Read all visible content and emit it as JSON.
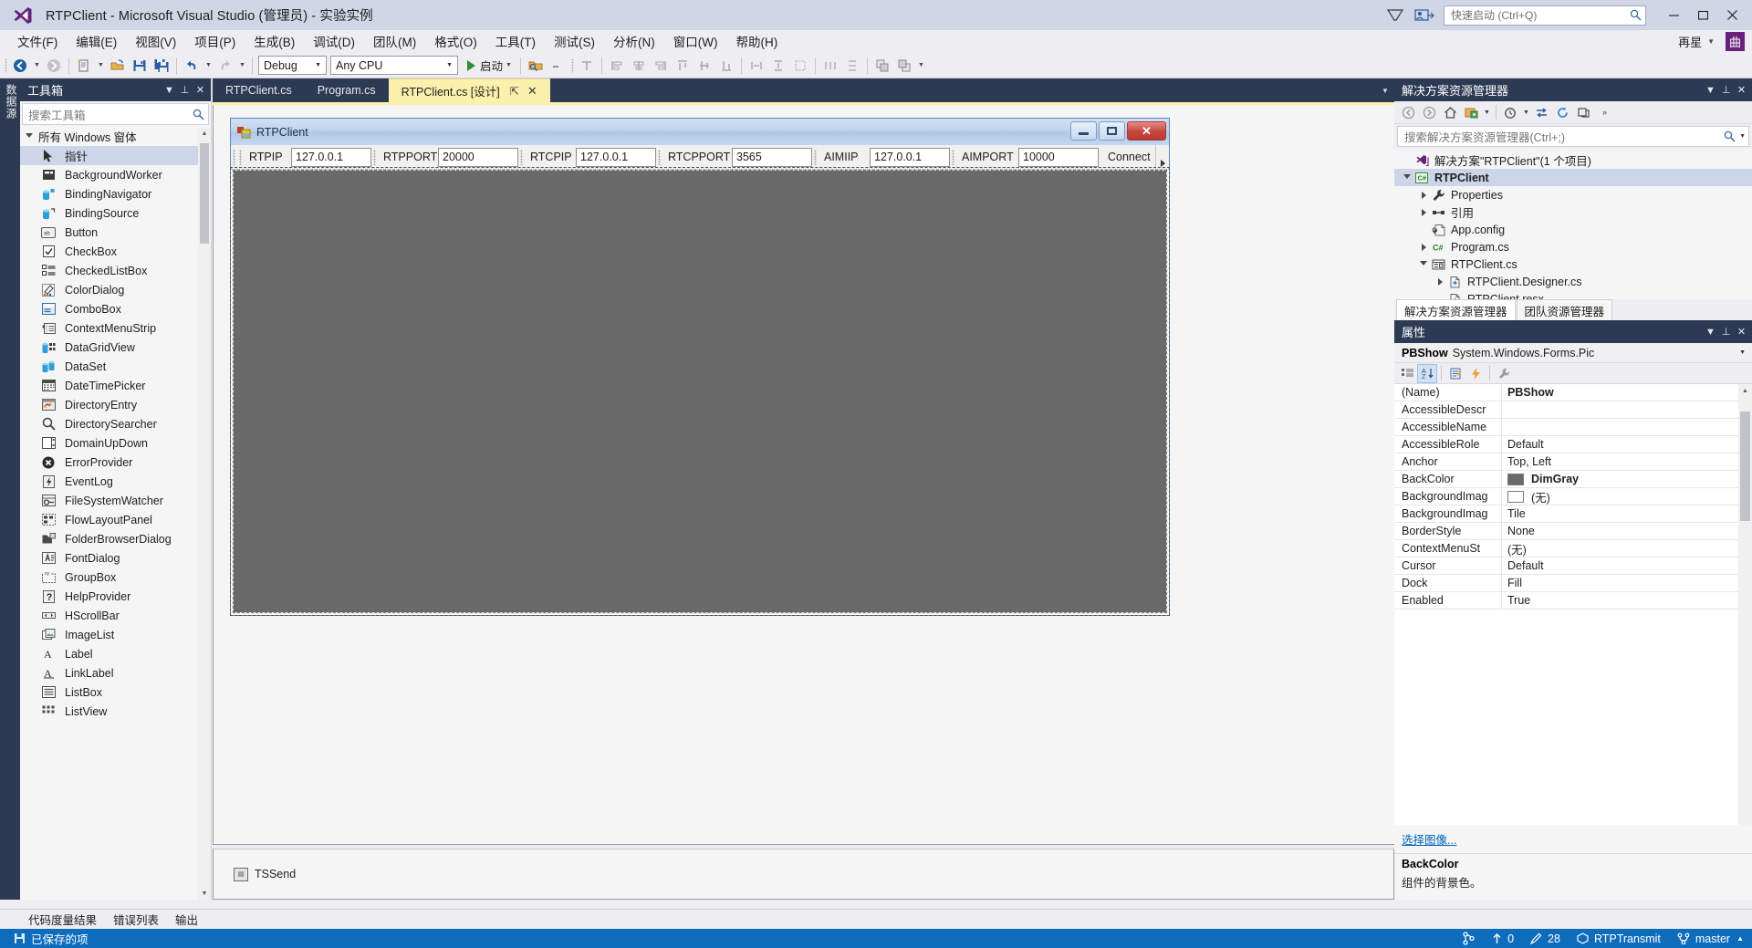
{
  "titlebar": {
    "title": "RTPClient - Microsoft Visual Studio (管理员) - 实验实例",
    "quick_launch_placeholder": "快速启动 (Ctrl+Q)",
    "minimize": "—",
    "maximize": "❐",
    "close": "✕"
  },
  "menubar": {
    "items": [
      {
        "label": "文件(F)"
      },
      {
        "label": "编辑(E)"
      },
      {
        "label": "视图(V)"
      },
      {
        "label": "项目(P)"
      },
      {
        "label": "生成(B)"
      },
      {
        "label": "调试(D)"
      },
      {
        "label": "团队(M)"
      },
      {
        "label": "格式(O)"
      },
      {
        "label": "工具(T)"
      },
      {
        "label": "测试(S)"
      },
      {
        "label": "分析(N)"
      },
      {
        "label": "窗口(W)"
      },
      {
        "label": "帮助(H)"
      }
    ],
    "right_label": "再星",
    "badge": "曲"
  },
  "toolbar": {
    "configuration": "Debug",
    "platform": "Any CPU",
    "start_label": "启动"
  },
  "toolbox": {
    "title": "工具箱",
    "search_placeholder": "搜索工具箱",
    "group_label": "所有 Windows 窗体",
    "items": [
      {
        "label": "指针",
        "icon": "pointer-icon",
        "selected": true
      },
      {
        "label": "BackgroundWorker",
        "icon": "backgroundworker-icon"
      },
      {
        "label": "BindingNavigator",
        "icon": "bindingnavigator-icon"
      },
      {
        "label": "BindingSource",
        "icon": "bindingsource-icon"
      },
      {
        "label": "Button",
        "icon": "button-icon"
      },
      {
        "label": "CheckBox",
        "icon": "checkbox-icon"
      },
      {
        "label": "CheckedListBox",
        "icon": "checkedlistbox-icon"
      },
      {
        "label": "ColorDialog",
        "icon": "colordialog-icon"
      },
      {
        "label": "ComboBox",
        "icon": "combobox-icon"
      },
      {
        "label": "ContextMenuStrip",
        "icon": "contextmenustrip-icon"
      },
      {
        "label": "DataGridView",
        "icon": "datagridview-icon"
      },
      {
        "label": "DataSet",
        "icon": "dataset-icon"
      },
      {
        "label": "DateTimePicker",
        "icon": "datetimepicker-icon"
      },
      {
        "label": "DirectoryEntry",
        "icon": "directoryentry-icon"
      },
      {
        "label": "DirectorySearcher",
        "icon": "directorysearcher-icon"
      },
      {
        "label": "DomainUpDown",
        "icon": "domainupdown-icon"
      },
      {
        "label": "ErrorProvider",
        "icon": "errorprovider-icon"
      },
      {
        "label": "EventLog",
        "icon": "eventlog-icon"
      },
      {
        "label": "FileSystemWatcher",
        "icon": "filesystemwatcher-icon"
      },
      {
        "label": "FlowLayoutPanel",
        "icon": "flowlayoutpanel-icon"
      },
      {
        "label": "FolderBrowserDialog",
        "icon": "folderbrowserdialog-icon"
      },
      {
        "label": "FontDialog",
        "icon": "fontdialog-icon"
      },
      {
        "label": "GroupBox",
        "icon": "groupbox-icon"
      },
      {
        "label": "HelpProvider",
        "icon": "helpprovider-icon"
      },
      {
        "label": "HScrollBar",
        "icon": "hscrollbar-icon"
      },
      {
        "label": "ImageList",
        "icon": "imagelist-icon"
      },
      {
        "label": "Label",
        "icon": "label-icon"
      },
      {
        "label": "LinkLabel",
        "icon": "linklabel-icon"
      },
      {
        "label": "ListBox",
        "icon": "listbox-icon"
      },
      {
        "label": "ListView",
        "icon": "listview-icon"
      }
    ]
  },
  "dockstrip_label": "数据源",
  "editor": {
    "tabs": [
      {
        "label": "RTPClient.cs",
        "active": false
      },
      {
        "label": "Program.cs",
        "active": false
      },
      {
        "label": "RTPClient.cs [设计]",
        "active": true,
        "pin": "⇲",
        "close": "✕"
      }
    ]
  },
  "designer": {
    "form_title": "RTPClient",
    "fields": [
      {
        "label": "RTPIP",
        "value": "127.0.0.1",
        "label_w": 52,
        "input_w": 88
      },
      {
        "label": "RTPPORT",
        "value": "20000",
        "label_w": 66,
        "input_w": 88
      },
      {
        "label": "RTCPIP",
        "value": "127.0.0.1",
        "label_w": 56,
        "input_w": 88
      },
      {
        "label": "RTCPPORT",
        "value": "3565",
        "label_w": 76,
        "input_w": 88
      },
      {
        "label": "AIMIIP",
        "value": "127.0.0.1",
        "label_w": 56,
        "input_w": 88
      },
      {
        "label": "AIMPORT",
        "value": "10000",
        "label_w": 68,
        "input_w": 88
      }
    ],
    "connect_label": "Connect",
    "component_tray": "TSSend",
    "picturebox_color": "#696969"
  },
  "solution_explorer": {
    "title": "解决方案资源管理器",
    "search_placeholder": "搜索解决方案资源管理器(Ctrl+;)",
    "tree": [
      {
        "label": "解决方案\"RTPClient\"(1 个项目)",
        "indent": 6,
        "expander": "none",
        "icon": "solution-icon",
        "bold": false
      },
      {
        "label": "RTPClient",
        "indent": 6,
        "expander": "open",
        "icon": "csproj-icon",
        "bold": true
      },
      {
        "label": "Properties",
        "indent": 24,
        "expander": "closed",
        "icon": "wrench-icon",
        "bold": false
      },
      {
        "label": "引用",
        "indent": 24,
        "expander": "closed",
        "icon": "reference-icon",
        "bold": false
      },
      {
        "label": "App.config",
        "indent": 24,
        "expander": "none",
        "icon": "config-icon",
        "bold": false
      },
      {
        "label": "Program.cs",
        "indent": 24,
        "expander": "closed",
        "icon": "cs-icon",
        "bold": false
      },
      {
        "label": "RTPClient.cs",
        "indent": 24,
        "expander": "open",
        "icon": "form-icon",
        "bold": false
      },
      {
        "label": "RTPClient.Designer.cs",
        "indent": 42,
        "expander": "closed",
        "icon": "file-icon",
        "bold": false
      },
      {
        "label": "RTPClient.resx",
        "indent": 42,
        "expander": "none",
        "icon": "file-icon",
        "bold": false
      }
    ],
    "tabs": [
      {
        "label": "解决方案资源管理器",
        "active": true
      },
      {
        "label": "团队资源管理器",
        "active": false
      }
    ]
  },
  "properties": {
    "title": "属性",
    "object_name": "PBShow",
    "object_type": "System.Windows.Forms.Pic",
    "rows": [
      {
        "name": "(Name)",
        "value": "PBShow",
        "bold": true,
        "swatch": null
      },
      {
        "name": "AccessibleDescr",
        "value": "",
        "bold": false,
        "swatch": null
      },
      {
        "name": "AccessibleName",
        "value": "",
        "bold": false,
        "swatch": null
      },
      {
        "name": "AccessibleRole",
        "value": "Default",
        "bold": false,
        "swatch": null
      },
      {
        "name": "Anchor",
        "value": "Top, Left",
        "bold": false,
        "swatch": null
      },
      {
        "name": "BackColor",
        "value": "DimGray",
        "bold": true,
        "swatch": "#696969"
      },
      {
        "name": "BackgroundImag",
        "value": "(无)",
        "bold": false,
        "swatch": "#ffffff"
      },
      {
        "name": "BackgroundImag",
        "value": "Tile",
        "bold": false,
        "swatch": null
      },
      {
        "name": "BorderStyle",
        "value": "None",
        "bold": false,
        "swatch": null
      },
      {
        "name": "ContextMenuSt",
        "value": "(无)",
        "bold": false,
        "swatch": null
      },
      {
        "name": "Cursor",
        "value": "Default",
        "bold": false,
        "swatch": null
      },
      {
        "name": "Dock",
        "value": "Fill",
        "bold": false,
        "swatch": null
      },
      {
        "name": "Enabled",
        "value": "True",
        "bold": false,
        "swatch": null
      }
    ],
    "choose_image_link": "选择图像...",
    "desc_title": "BackColor",
    "desc_body": "组件的背景色。"
  },
  "lower_tabs": [
    {
      "label": "代码度量结果"
    },
    {
      "label": "错误列表"
    },
    {
      "label": "输出"
    }
  ],
  "statusbar": {
    "left_text": "已保存的项",
    "pending_changes": "0",
    "changes_count": "28",
    "workspace": "RTPTransmit",
    "branch": "master"
  },
  "colors": {
    "accent_blue": "#0e6cbd",
    "panel_header": "#2d3a53",
    "active_tab": "#fcf0ad",
    "vs_purple": "#68217a"
  }
}
